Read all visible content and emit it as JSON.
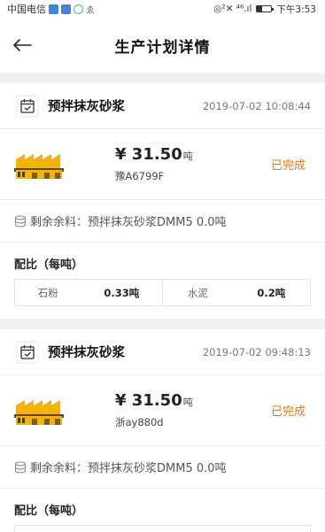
{
  "status_bar": {
    "carrier": "中国电信",
    "signal": "◎²✕ ⁴⁶.ıl",
    "time": "下午3:53",
    "app_icon_colors": [
      "#2f8be8",
      "#4a7ee0",
      "#3ccf6b"
    ]
  },
  "header": {
    "title": "生产计划详情"
  },
  "colors": {
    "accent_status": "#e07b22",
    "factory_yellow": "#f4b400"
  },
  "orders": [
    {
      "product": "预拌抹灰砂浆",
      "time": "2019-07-02 10:08:44",
      "price": "¥ 31.50",
      "price_unit": "吨",
      "plate": "豫A6799F",
      "status": "已完成",
      "remain_label": "剩余余料：",
      "remain_value": "预拌抹灰砂浆DMM5 0.0吨",
      "ratio_title": "配比（每吨）",
      "ratio": [
        {
          "name": "石粉",
          "value": "0.33吨"
        },
        {
          "name": "水泥",
          "value": "0.2吨"
        }
      ]
    },
    {
      "product": "预拌抹灰砂浆",
      "time": "2019-07-02 09:48:13",
      "price": "¥ 31.50",
      "price_unit": "吨",
      "plate": "浙ay880d",
      "status": "已完成",
      "remain_label": "剩余余料：",
      "remain_value": "预拌抹灰砂浆DMM5 0.0吨",
      "ratio_title": "配比（每吨）"
    }
  ]
}
